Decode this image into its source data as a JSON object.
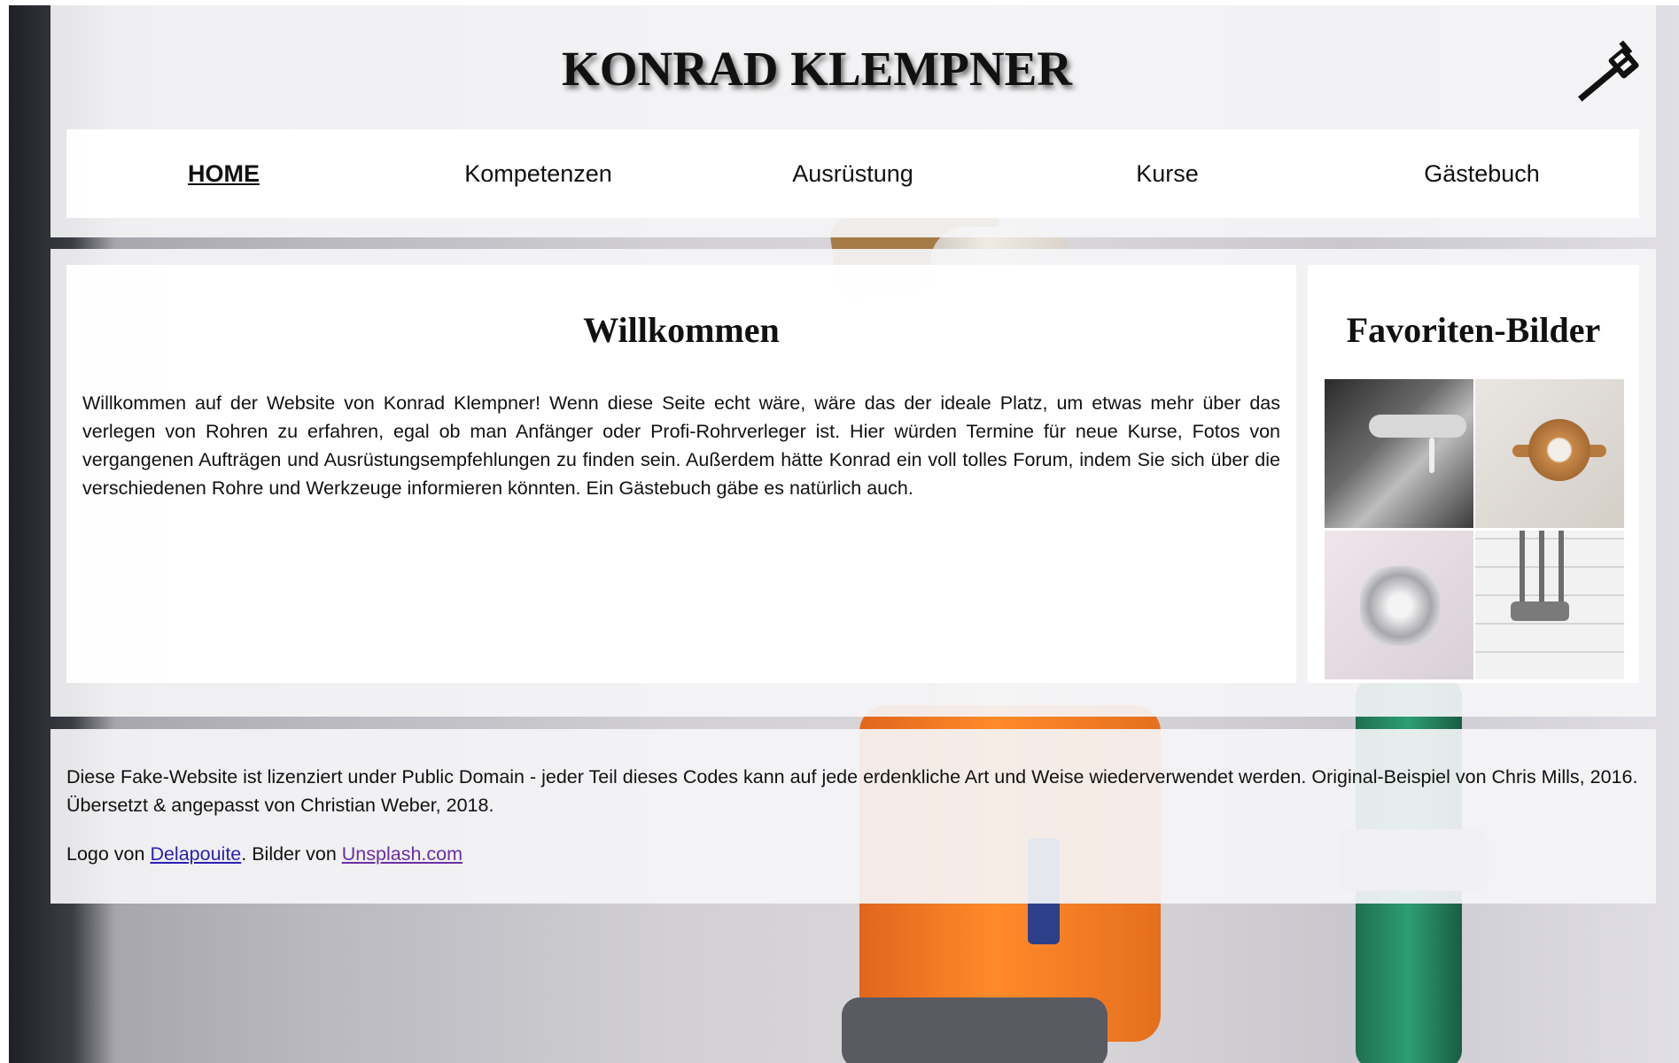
{
  "header": {
    "title": "KONRAD KLEMPNER",
    "logo_icon": "pipe-wrench-icon"
  },
  "nav": {
    "items": [
      {
        "label": "HOME",
        "active": true
      },
      {
        "label": "Kompetenzen"
      },
      {
        "label": "Ausrüstung"
      },
      {
        "label": "Kurse"
      },
      {
        "label": "Gästebuch"
      }
    ]
  },
  "main": {
    "heading": "Willkommen",
    "text": "Willkommen auf der Website von Konrad Klempner! Wenn diese Seite echt wäre, wäre das der ideale Platz, um etwas mehr über das verlegen von Rohren zu erfahren, egal ob man Anfänger oder Profi-Rohrverleger ist. Hier würden Termine für neue Kurse, Fotos von vergangenen Aufträgen und Ausrüstungsempfehlungen zu finden sein. Außerdem hätte Konrad ein voll tolles Forum, indem Sie sich über die verschiedenen Rohre und Werkzeuge informieren könnten. Ein Gästebuch gäbe es natürlich auch."
  },
  "aside": {
    "heading": "Favoriten-Bilder",
    "images": [
      "dripping-faucet-image",
      "brass-tap-image",
      "chrome-valve-image",
      "wall-pipes-image"
    ]
  },
  "footer": {
    "license": "Diese Fake-Website ist lizenziert under Public Domain - jeder Teil dieses Codes kann auf jede erdenkliche Art und Weise wiederverwendet werden. Original-Beispiel von Chris Mills, 2016. Übersetzt & angepasst von Christian Weber, 2018.",
    "credits_prefix": "Logo von ",
    "logo_link": "Delapouite",
    "credits_middle": ". Bilder von ",
    "images_link": "Unsplash.com"
  },
  "colors": {
    "link": "#2a1fb4",
    "visited_link": "#6b2ea1",
    "hose": "#ff8a2a"
  }
}
